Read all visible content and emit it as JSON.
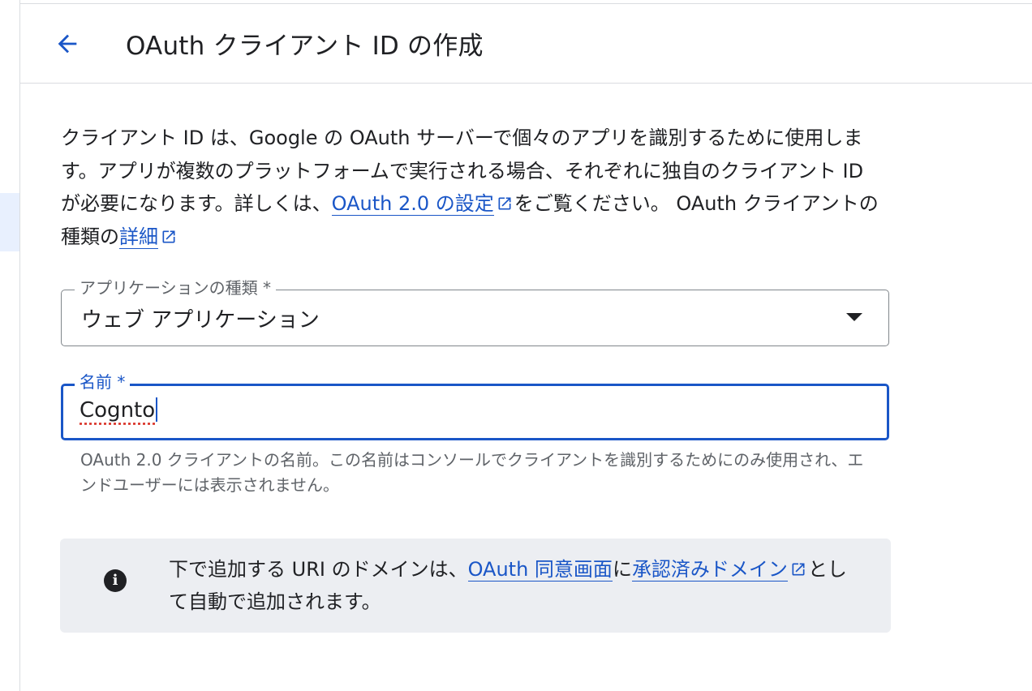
{
  "header": {
    "back_icon": "arrow-back-icon",
    "title": "OAuth クライアント ID の作成"
  },
  "description": {
    "text_1": "クライアント ID は、Google の OAuth サーバーで個々のアプリを識別するために使用します。アプリが複数のプラットフォームで実行される場合、それぞれに独自のクライアント ID が必要になります。詳しくは、",
    "link_1": "OAuth 2.0 の設定",
    "text_2": "をご覧ください。 OAuth クライアントの種類の",
    "link_2": "詳細"
  },
  "app_type_field": {
    "label": "アプリケーションの種類 *",
    "value": "ウェブ アプリケーション"
  },
  "name_field": {
    "label": "名前 *",
    "value": "Cognto",
    "helper": "OAuth 2.0 クライアントの名前。この名前はコンソールでクライアントを識別するためにのみ使用され、エンドユーザーには表示されません。"
  },
  "info_box": {
    "icon": "info-icon",
    "text_1": "下で追加する URI のドメインは、",
    "link_1": "OAuth 同意画面",
    "text_2": "に",
    "link_2": "承認済みドメイン",
    "text_3": "として自動で追加されます。"
  },
  "colors": {
    "link": "#1a56c7",
    "focus_border": "#1a56c7",
    "info_bg": "#eceef2"
  }
}
